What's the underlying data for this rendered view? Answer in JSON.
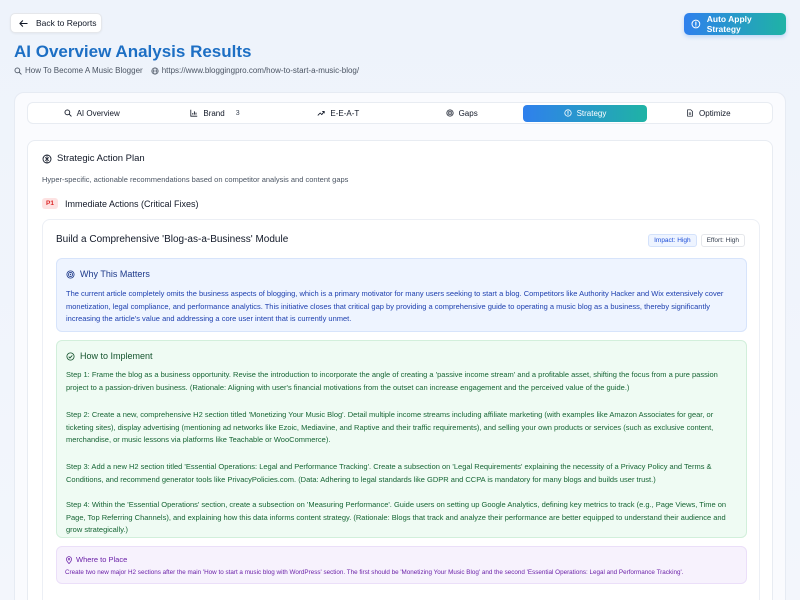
{
  "header": {
    "back_label": "Back to Reports",
    "auto_apply_label": "Auto Apply Strategy",
    "title": "AI Overview Analysis Results",
    "keyword": "How To Become A Music Blogger",
    "url": "https://www.bloggingpro.com/how-to-start-a-music-blog/"
  },
  "tabs": [
    {
      "label": "AI Overview",
      "icon": "search-icon"
    },
    {
      "label": "Brand",
      "icon": "bar-chart-icon",
      "count": "3"
    },
    {
      "label": "E-E-A-T",
      "icon": "trending-up-icon"
    },
    {
      "label": "Gaps",
      "icon": "target-icon"
    },
    {
      "label": "Strategy",
      "icon": "compass-icon",
      "active": true
    },
    {
      "label": "Optimize",
      "icon": "document-icon"
    }
  ],
  "plan": {
    "title": "Strategic Action Plan",
    "subtitle": "Hyper-specific, actionable recommendations based on competitor analysis and content gaps",
    "priority_badge": "P1",
    "priority_label": "Immediate Actions (Critical Fixes)"
  },
  "action": {
    "title": "Build a Comprehensive 'Blog-as-a-Business' Module",
    "impact": "Impact: High",
    "effort": "Effort: High",
    "why_title": "Why This Matters",
    "why_text": "The current article completely omits the business aspects of blogging, which is a primary motivator for many users seeking to start a blog. Competitors like Authority Hacker and Wix extensively cover monetization, legal compliance, and performance analytics. This initiative closes that critical gap by providing a comprehensive guide to operating a music blog as a business, thereby significantly increasing the article's value and addressing a core user intent that is currently unmet.",
    "how_title": "How to Implement",
    "steps": [
      "Step 1: Frame the blog as a business opportunity. Revise the introduction to incorporate the angle of creating a 'passive income stream' and a profitable asset, shifting the focus from a pure passion project to a passion-driven business. (Rationale: Aligning with user's financial motivations from the outset can increase engagement and the perceived value of the guide.)",
      "Step 2: Create a new, comprehensive H2 section titled 'Monetizing Your Music Blog'. Detail multiple income streams including affiliate marketing (with examples like Amazon Associates for gear, or ticketing sites), display advertising (mentioning ad networks like Ezoic, Mediavine, and Raptive and their traffic requirements), and selling your own products or services (such as exclusive content, merchandise, or music lessons via platforms like Teachable or WooCommerce).",
      "Step 3: Add a new H2 section titled 'Essential Operations: Legal and Performance Tracking'. Create a subsection on 'Legal Requirements' explaining the necessity of a Privacy Policy and Terms & Conditions, and recommend generator tools like PrivacyPolicies.com. (Data: Adhering to legal standards like GDPR and CCPA is mandatory for many blogs and builds user trust.)",
      "Step 4: Within the 'Essential Operations' section, create a subsection on 'Measuring Performance'. Guide users on setting up Google Analytics, defining key metrics to track (e.g., Page Views, Time on Page, Top Referring Channels), and explaining how this data informs content strategy. (Rationale: Blogs that track and analyze their performance are better equipped to understand their audience and grow strategically.)"
    ],
    "where_title": "Where to Place",
    "where_text": "Create two new major H2 sections after the main 'How to start a music blog with WordPress' section. The first should be 'Monetizing Your Music Blog' and the second 'Essential Operations: Legal and Performance Tracking'."
  },
  "colors": {
    "accent_start": "#2f80ed",
    "accent_end": "#1fb3a5",
    "title": "#1d6fc4"
  }
}
